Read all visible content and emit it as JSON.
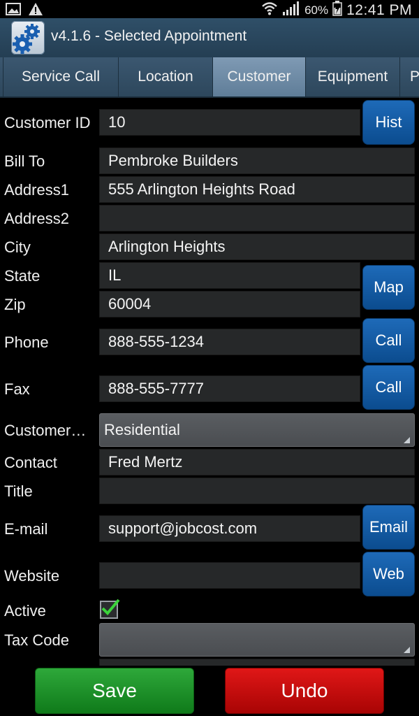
{
  "status_bar": {
    "icons_left": [
      "picture-icon",
      "warning-icon"
    ],
    "icons_right": [
      "wifi-icon",
      "signal-icon",
      "battery-icon"
    ],
    "battery": "60%",
    "time": "12:41 PM"
  },
  "app": {
    "title": "v4.1.6 - Selected Appointment",
    "icon": "gear-icon"
  },
  "tabs": [
    {
      "label": "Service Call",
      "active": false
    },
    {
      "label": "Location",
      "active": false
    },
    {
      "label": "Customer",
      "active": true
    },
    {
      "label": "Equipment",
      "active": false
    },
    {
      "label": "Pho",
      "active": false
    }
  ],
  "form": {
    "customer_id": {
      "label": "Customer ID",
      "value": "10",
      "button": "Hist"
    },
    "bill_to": {
      "label": "Bill To",
      "value": "Pembroke Builders"
    },
    "address1": {
      "label": "Address1",
      "value": "555 Arlington Heights Road"
    },
    "address2": {
      "label": "Address2",
      "value": ""
    },
    "city": {
      "label": "City",
      "value": "Arlington Heights"
    },
    "state": {
      "label": "State",
      "value": "IL"
    },
    "zip": {
      "label": "Zip",
      "value": "60004"
    },
    "map_button": "Map",
    "phone": {
      "label": "Phone",
      "value": "888-555-1234",
      "button": "Call"
    },
    "fax": {
      "label": "Fax",
      "value": "888-555-7777",
      "button": "Call"
    },
    "customer_type": {
      "label": "Customer…",
      "value": "Residential"
    },
    "contact": {
      "label": "Contact",
      "value": "Fred Mertz"
    },
    "title": {
      "label": "Title",
      "value": ""
    },
    "email": {
      "label": "E-mail",
      "value": "support@jobcost.com",
      "button": "Email"
    },
    "website": {
      "label": "Website",
      "value": "",
      "button": "Web"
    },
    "active": {
      "label": "Active",
      "checked": true
    },
    "tax_code": {
      "label": "Tax Code",
      "value": ""
    }
  },
  "actions": {
    "save": "Save",
    "undo": "Undo"
  },
  "colors": {
    "accent_blue": "#0b4c8f",
    "save_green": "#1a8f26",
    "undo_red": "#c80a0a",
    "check_green": "#3bd43b"
  }
}
